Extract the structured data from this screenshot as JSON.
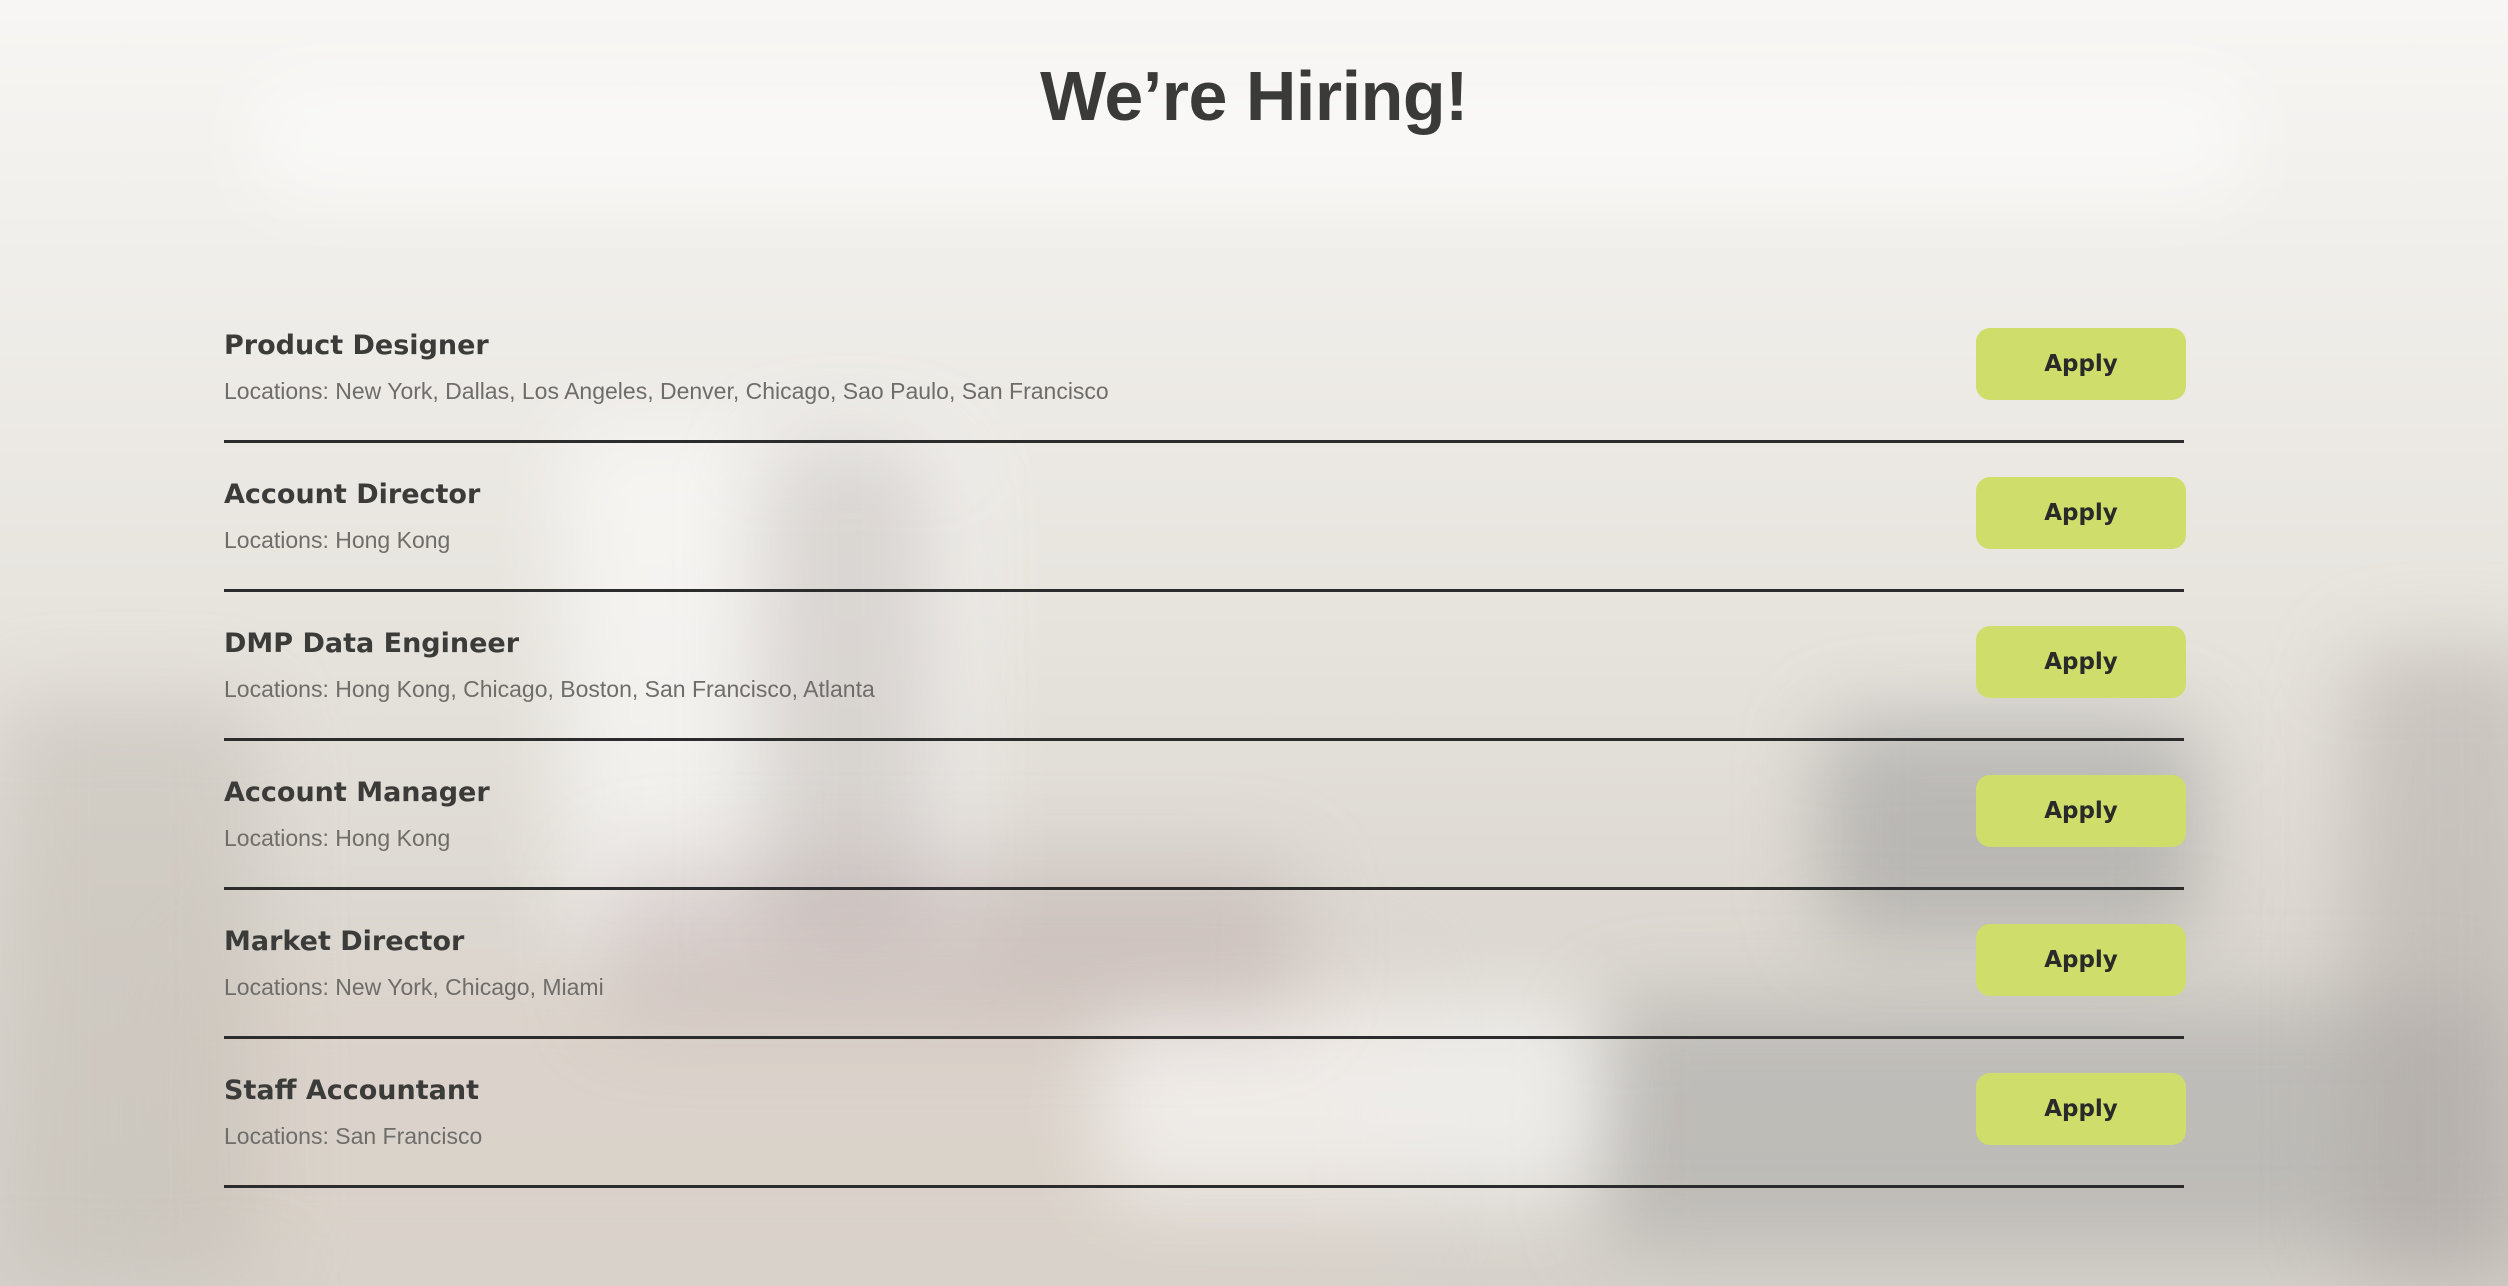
{
  "header": {
    "title": "We’re Hiring!"
  },
  "jobs": [
    {
      "title": "Product Designer",
      "locations": "Locations: New York, Dallas, Los Angeles, Denver, Chicago, Sao Paulo, San Francisco",
      "button_label": "Apply"
    },
    {
      "title": "Account Director",
      "locations": "Locations: Hong Kong",
      "button_label": "Apply"
    },
    {
      "title": "DMP Data Engineer",
      "locations": "Locations: Hong Kong, Chicago, Boston, San Francisco, Atlanta",
      "button_label": "Apply"
    },
    {
      "title": "Account Manager",
      "locations": "Locations: Hong Kong",
      "button_label": "Apply"
    },
    {
      "title": "Market Director",
      "locations": "Locations: New York, Chicago, Miami",
      "button_label": "Apply"
    },
    {
      "title": "Staff Accountant",
      "locations": "Locations: San Francisco",
      "button_label": "Apply"
    }
  ],
  "colors": {
    "accent": "#cfdd6b",
    "text_dark": "#3b3b39",
    "text_muted": "#6f6d69",
    "divider": "#2c2c2c"
  }
}
